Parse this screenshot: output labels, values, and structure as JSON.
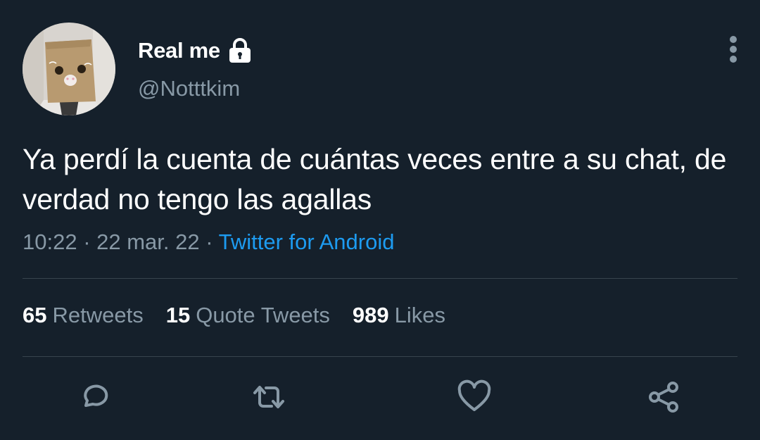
{
  "user": {
    "display_name": "Real me",
    "handle": "@Notttkim"
  },
  "tweet": {
    "text": "Ya perdí la cuenta de cuántas veces entre a su chat, de verdad no tengo las agallas",
    "time": "10:22",
    "separator": " · ",
    "date": "22 mar. 22",
    "source": "Twitter for Android"
  },
  "stats": {
    "retweets_count": "65",
    "retweets_label": "Retweets",
    "quotes_count": "15",
    "quotes_label": "Quote Tweets",
    "likes_count": "989",
    "likes_label": "Likes"
  },
  "icons": {
    "lock": "lock-icon",
    "more": "more-vertical-icon",
    "reply": "reply-icon",
    "retweet": "retweet-icon",
    "like": "heart-icon",
    "share": "share-icon"
  },
  "colors": {
    "background": "#15202b",
    "text": "#ffffff",
    "secondary": "#8899a6",
    "link": "#1d9bf0",
    "divider": "#38444d"
  }
}
